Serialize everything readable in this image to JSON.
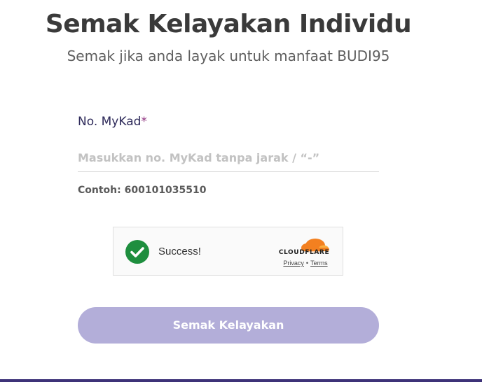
{
  "header": {
    "title": "Semak Kelayakan Individu",
    "subtitle": "Semak jika anda layak untuk manfaat BUDI95"
  },
  "form": {
    "mykad_label": "No. MyKad",
    "required_mark": "*",
    "mykad_placeholder": "Masukkan no. MyKad tanpa jarak / “-”",
    "mykad_value": "",
    "example_hint": "Contoh: 600101035510"
  },
  "captcha": {
    "status_text": "Success!",
    "status_icon": "check-circle-icon",
    "brand": "CLOUDFLARE",
    "privacy_link": "Privacy",
    "separator": "•",
    "terms_link": "Terms",
    "success_color": "#1e8e3e",
    "brand_color": "#f38020"
  },
  "actions": {
    "submit_label": "Semak Kelayakan",
    "submit_color": "#b3aed9"
  },
  "theme": {
    "accent": "#3d3278",
    "required_color": "#8b2b7a"
  }
}
